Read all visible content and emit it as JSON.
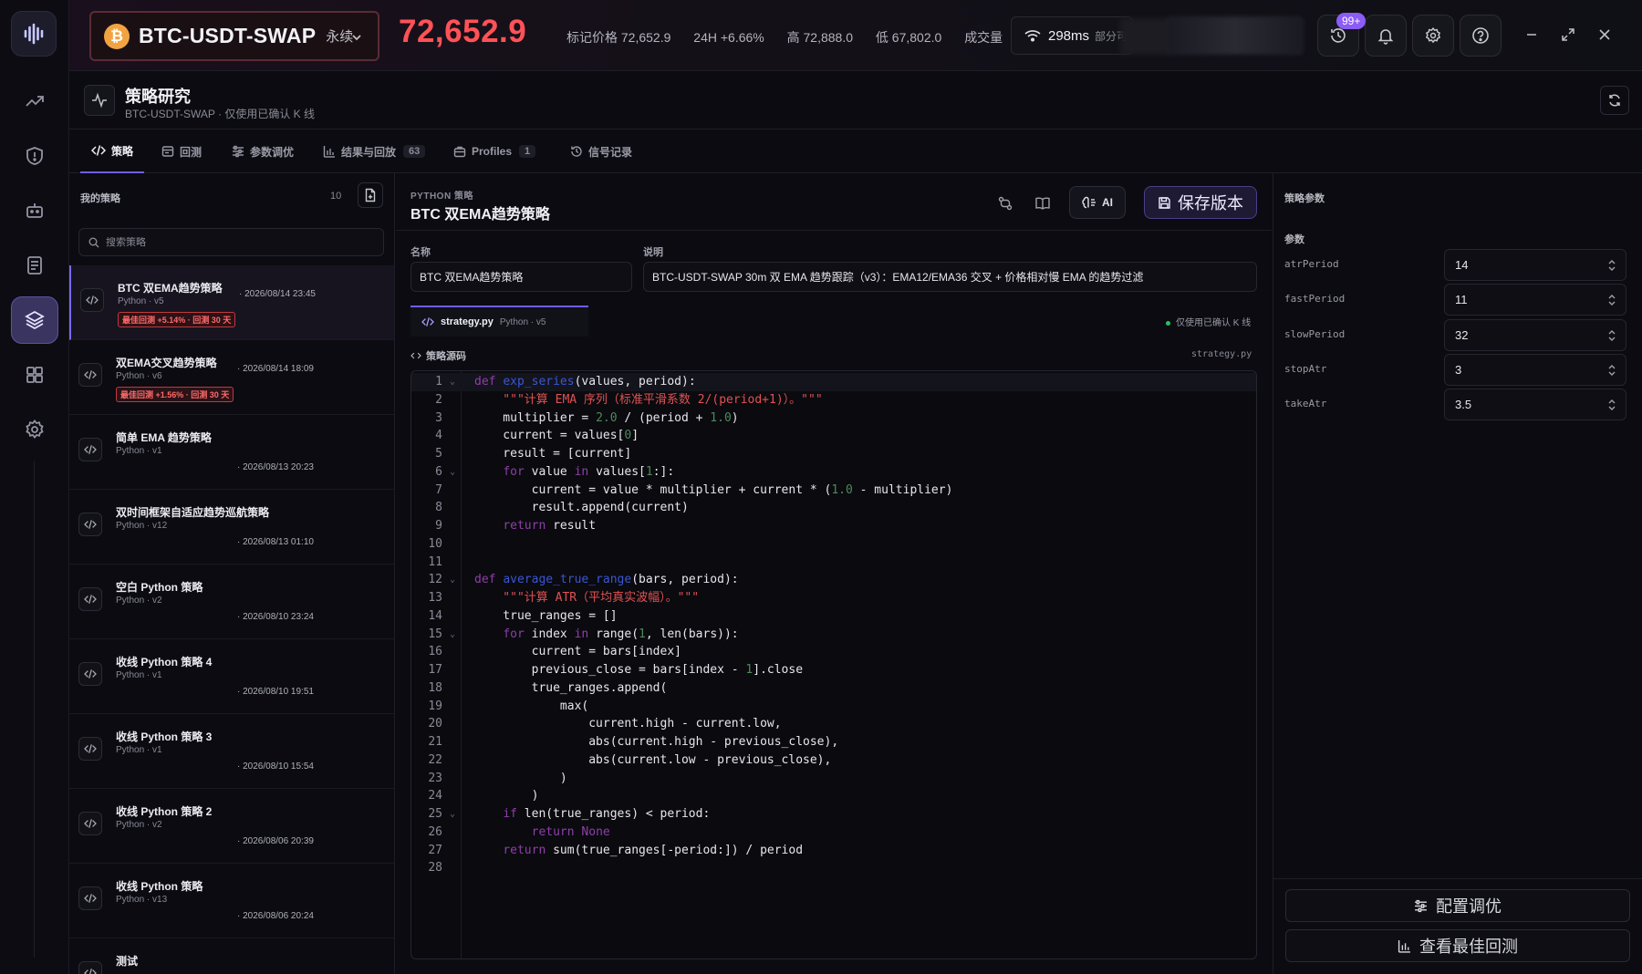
{
  "topbar": {
    "symbol": "BTC-USDT-SWAP",
    "coin_glyph": "₿",
    "contract_type": "永续",
    "last_price": "72,652.9",
    "mark_price": "标记价格 72,652.9",
    "change_24h": "24H +6.66%",
    "high": "高 72,888.0",
    "low": "低 67,802.0",
    "volume_label": "成交量",
    "latency": "298ms",
    "latency_sub": "部分可",
    "notif_badge": "99+",
    "accent_color": "#6d5df0",
    "price_color": "#ff5257"
  },
  "header": {
    "title": "策略研究",
    "subtitle": "BTC-USDT-SWAP · 仅使用已确认 K 线"
  },
  "tabs": [
    {
      "label": "策略",
      "icon": "code-icon"
    },
    {
      "label": "回测",
      "icon": "backtest-icon"
    },
    {
      "label": "参数调优",
      "icon": "sliders-icon"
    },
    {
      "label": "结果与回放",
      "icon": "bar-chart-icon",
      "count": "63"
    },
    {
      "label": "Profiles",
      "icon": "briefcase-icon",
      "count": "1"
    },
    {
      "label": "信号记录",
      "icon": "history-icon"
    }
  ],
  "strategies": {
    "title": "我的策略",
    "count": "10",
    "search_placeholder": "搜索策略",
    "items": [
      {
        "name": "BTC 双EMA趋势策略",
        "meta": "Python · v5",
        "date": "2026/08/14 23:45",
        "tag": "最佳回测 +5.14% · 回测 30 天"
      },
      {
        "name": "双EMA交叉趋势策略",
        "meta": "Python · v6",
        "date": "2026/08/14 18:09",
        "tag": "最佳回测 +1.56% · 回测 30 天"
      },
      {
        "name": "简单 EMA 趋势策略",
        "meta": "Python · v1",
        "date": "2026/08/13 20:23"
      },
      {
        "name": "双时间框架自适应趋势巡航策略",
        "meta": "Python · v12",
        "date": "2026/08/13 01:10"
      },
      {
        "name": "空白 Python 策略",
        "meta": "Python · v2",
        "date": "2026/08/10 23:24"
      },
      {
        "name": "收线 Python 策略 4",
        "meta": "Python · v1",
        "date": "2026/08/10 19:51"
      },
      {
        "name": "收线 Python 策略 3",
        "meta": "Python · v1",
        "date": "2026/08/10 15:54"
      },
      {
        "name": "收线 Python 策略 2",
        "meta": "Python · v2",
        "date": "2026/08/06 20:39"
      },
      {
        "name": "收线 Python 策略",
        "meta": "Python · v13",
        "date": "2026/08/06 20:24"
      },
      {
        "name": "测试",
        "meta": "",
        "date": ""
      }
    ]
  },
  "editor": {
    "kicker": "PYTHON 策略",
    "title": "BTC 双EMA趋势策略",
    "ai_label": "AI",
    "save_label": "保存版本",
    "name_label": "名称",
    "name_value": "BTC 双EMA趋势策略",
    "desc_label": "说明",
    "desc_value": "BTC-USDT-SWAP 30m 双 EMA 趋势跟踪（v3）：EMA12/EMA36 交叉 + 价格相对慢 EMA 的趋势过滤",
    "file_tab": "strategy.py",
    "file_tab_sub": "Python · v5",
    "confirmed_note": "仅使用已确认 K 线",
    "source_label": "策略源码",
    "source_file": "strategy.py",
    "code_lines": [
      "def exp_series(values, period):",
      "    \"\"\"计算 EMA 序列（标准平滑系数 2/(period+1)）。\"\"\"",
      "    multiplier = 2.0 / (period + 1.0)",
      "    current = values[0]",
      "    result = [current]",
      "    for value in values[1:]:",
      "        current = value * multiplier + current * (1.0 - multiplier)",
      "        result.append(current)",
      "    return result",
      "",
      "",
      "def average_true_range(bars, period):",
      "    \"\"\"计算 ATR（平均真实波幅）。\"\"\"",
      "    true_ranges = []",
      "    for index in range(1, len(bars)):",
      "        current = bars[index]",
      "        previous_close = bars[index - 1].close",
      "        true_ranges.append(",
      "            max(",
      "                current.high - current.low,",
      "                abs(current.high - previous_close),",
      "                abs(current.low - previous_close),",
      "            )",
      "        )",
      "    if len(true_ranges) < period:",
      "        return None",
      "    return sum(true_ranges[-period:]) / period",
      ""
    ],
    "fold_lines": [
      1,
      6,
      12,
      15,
      25
    ]
  },
  "params": {
    "title": "策略参数",
    "section": "参数",
    "items": [
      {
        "name": "atrPeriod",
        "value": "14"
      },
      {
        "name": "fastPeriod",
        "value": "11"
      },
      {
        "name": "slowPeriod",
        "value": "32"
      },
      {
        "name": "stopAtr",
        "value": "3"
      },
      {
        "name": "takeAtr",
        "value": "3.5"
      }
    ],
    "tune_label": "配置调优",
    "best_label": "查看最佳回测"
  }
}
